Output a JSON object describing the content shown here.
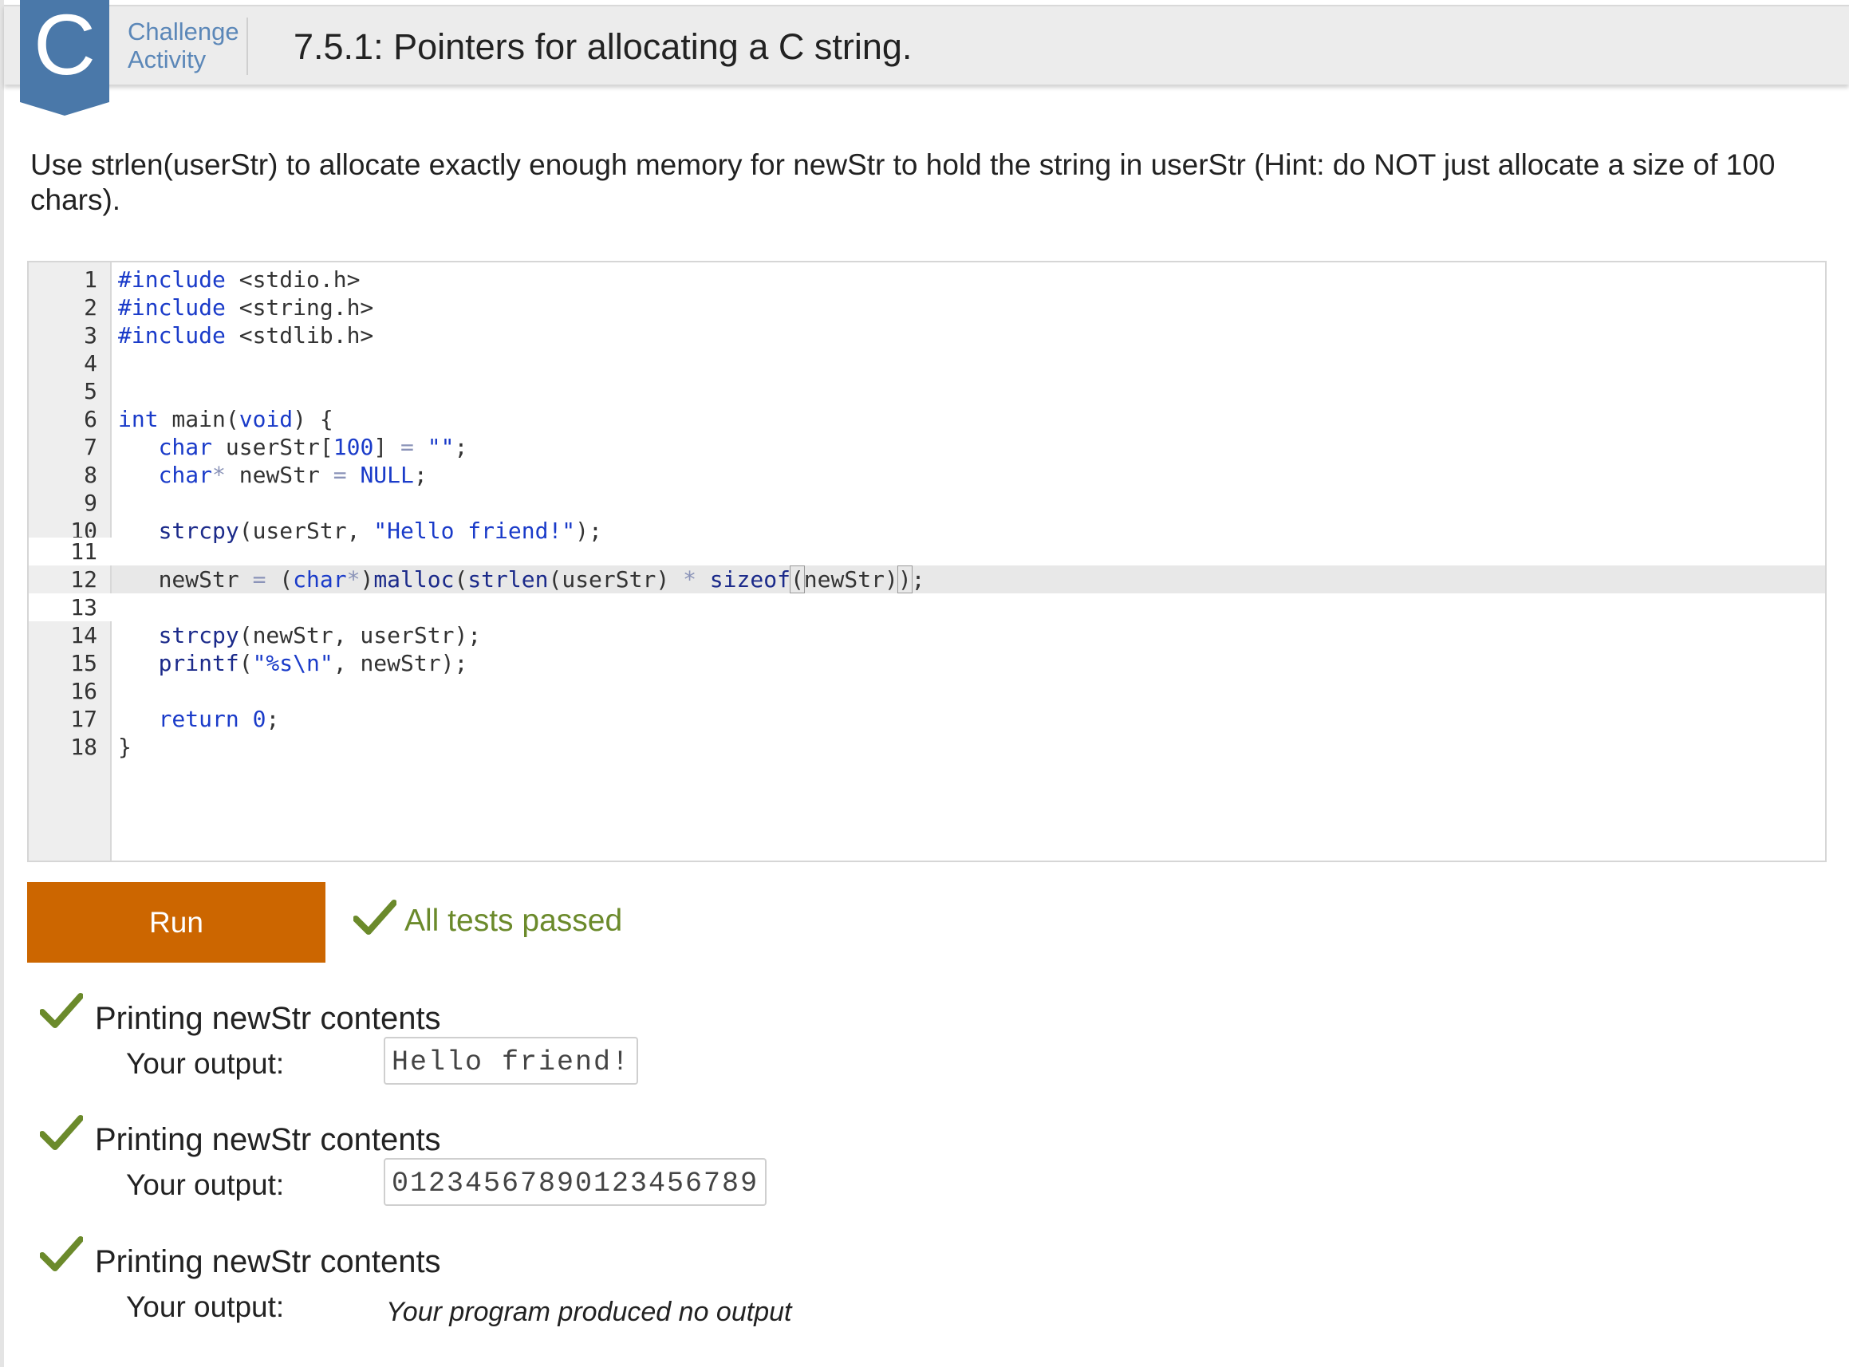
{
  "header": {
    "badge_letter": "C",
    "badge_label_line1": "Challenge",
    "badge_label_line2": "Activity",
    "title": "7.5.1: Pointers for allocating a C string."
  },
  "instructions": "Use strlen(userStr) to allocate exactly enough memory for newStr to hold the string in userStr (Hint: do NOT just allocate a size of 100 chars).",
  "editor": {
    "line_numbers": [
      "1",
      "2",
      "3",
      "4",
      "5",
      "6",
      "7",
      "8",
      "9",
      "10",
      "11",
      "12",
      "13",
      "14",
      "15",
      "16",
      "17",
      "18"
    ],
    "lines": {
      "l1": {
        "a": "#include",
        "b": " <stdio.h>"
      },
      "l2": {
        "a": "#include",
        "b": " <string.h>"
      },
      "l3": {
        "a": "#include",
        "b": " <stdlib.h>"
      },
      "l6": {
        "a": "int",
        "b": " main(",
        "c": "void",
        "d": ") {"
      },
      "l7": {
        "a": "   char",
        "b": " userStr[",
        "c": "100",
        "d": "] ",
        "e": "=",
        "f": " ",
        "g": "\"\"",
        "h": ";"
      },
      "l8": {
        "a": "   char",
        "b": "*",
        "c": " newStr ",
        "d": "=",
        "e": " ",
        "f": "NULL",
        "g": ";"
      },
      "l10": {
        "a": "   strcpy",
        "b": "(userStr, ",
        "c": "\"Hello friend!\"",
        "d": ");"
      },
      "l12": {
        "a": "   newStr ",
        "b": "=",
        "c": " (",
        "d": "char",
        "e": "*",
        "f": ")",
        "g": "malloc",
        "h": "(",
        "i": "strlen",
        "j": "(userStr) ",
        "k": "*",
        "l": " ",
        "m": "sizeof",
        "n": "(",
        "o": "newStr)",
        "p": ")",
        "q": ";"
      },
      "l14": {
        "a": "   strcpy",
        "b": "(newStr, userStr);"
      },
      "l15": {
        "a": "   printf",
        "b": "(",
        "c": "\"%s\\n\"",
        "d": ", newStr);"
      },
      "l17": {
        "a": "   return",
        "b": " ",
        "c": "0",
        "d": ";"
      },
      "l18": {
        "a": "}"
      }
    }
  },
  "run_label": "Run",
  "status": "All tests passed",
  "tests": [
    {
      "title": "Printing newStr contents",
      "output_label": "Your output:",
      "output": "Hello friend!"
    },
    {
      "title": "Printing newStr contents",
      "output_label": "Your output:",
      "output": "01234567890123456789"
    },
    {
      "title": "Printing newStr contents",
      "output_label": "Your output:",
      "output": "Your program produced no output"
    }
  ],
  "colors": {
    "badge": "#4a78a9",
    "run_button": "#cc6600",
    "check": "#6b8a2b",
    "keyword": "#1a3bc9"
  },
  "icons": [
    "challenge-badge-icon",
    "checkmark-icon"
  ]
}
